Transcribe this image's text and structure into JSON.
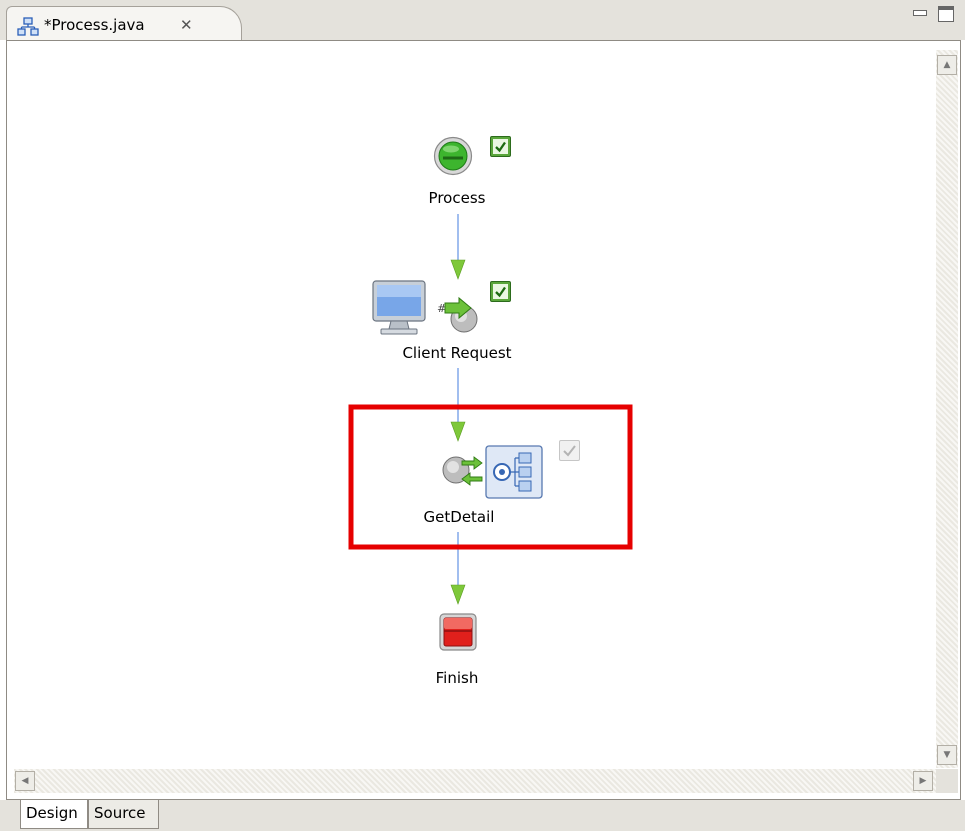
{
  "editor": {
    "tab_title": "*Process.java",
    "tab_close_icon": "close-icon",
    "tab_file_icon": "process-diagram-icon"
  },
  "window_controls": {
    "minimize_icon": "minimize-icon",
    "maximize_icon": "maximize-icon"
  },
  "diagram": {
    "nodes": [
      {
        "label": "Process",
        "icon": "start-node-icon",
        "status_icon": "validated-check-icon"
      },
      {
        "label": "Client Request",
        "icon": "client-request-icon",
        "status_icon": "validated-check-icon"
      },
      {
        "label": "GetDetail",
        "icon": "service-call-icon",
        "status_icon": "unvalidated-check-icon",
        "highlighted": true
      },
      {
        "label": "Finish",
        "icon": "end-node-icon"
      }
    ],
    "colors": {
      "connector": "#6e9ae6",
      "arrowhead": "#7ec83a",
      "highlight_box": "#e60000"
    }
  },
  "bottom_tabs": [
    {
      "label": "Design",
      "active": true
    },
    {
      "label": "Source",
      "active": false
    }
  ]
}
